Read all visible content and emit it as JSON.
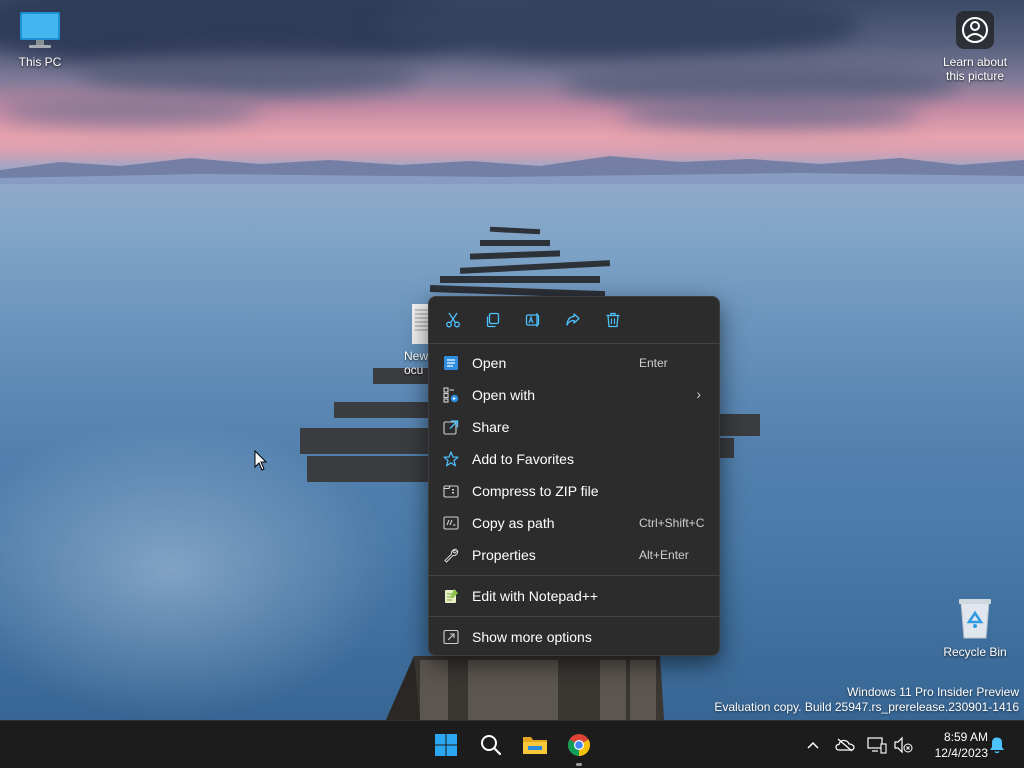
{
  "desktop": {
    "icons": {
      "this_pc": "This PC",
      "learn_about": "Learn about this picture",
      "new_document": "New Docu",
      "recycle_bin": "Recycle Bin"
    }
  },
  "context_menu": {
    "quick_actions": [
      "scissors-icon",
      "copy-icon",
      "rename-icon",
      "share-icon",
      "trash-icon"
    ],
    "items": [
      {
        "label": "Open",
        "shortcut": "Enter",
        "icon": "document-icon"
      },
      {
        "label": "Open with",
        "shortcut": "",
        "icon": "open-with-icon",
        "submenu": "›"
      },
      {
        "label": "Share",
        "shortcut": "",
        "icon": "share-icon"
      },
      {
        "label": "Add to Favorites",
        "shortcut": "",
        "icon": "star-icon"
      },
      {
        "label": "Compress to ZIP file",
        "shortcut": "",
        "icon": "zip-icon"
      },
      {
        "label": "Copy as path",
        "shortcut": "Ctrl+Shift+C",
        "icon": "copy-path-icon"
      },
      {
        "label": "Properties",
        "shortcut": "Alt+Enter",
        "icon": "wrench-icon"
      },
      {
        "label": "Edit with Notepad++",
        "shortcut": "",
        "icon": "notepadpp-icon"
      },
      {
        "label": "Show more options",
        "shortcut": "",
        "icon": "more-options-icon"
      }
    ]
  },
  "watermark": {
    "line1": "Windows 11 Pro Insider Preview",
    "line2": "Evaluation copy. Build 25947.rs_prerelease.230901-1416"
  },
  "taskbar": {
    "apps": [
      "windows-start-icon",
      "search-icon",
      "file-explorer-icon",
      "chrome-icon"
    ],
    "tray": [
      "chevron-up-icon",
      "onedrive-icon",
      "network-icon",
      "volume-muted-icon",
      "notification-bell-icon"
    ],
    "time": "8:59 AM",
    "date": "12/4/2023"
  },
  "colors": {
    "menu_bg": "#2c2c2c",
    "accent": "#4cc2ff",
    "taskbar_bg": "#1c1c1c"
  }
}
